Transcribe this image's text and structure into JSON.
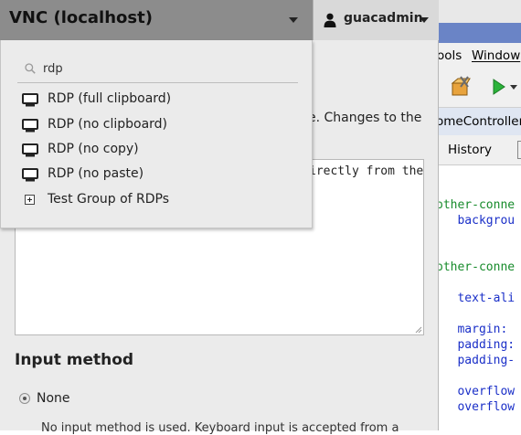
{
  "header": {
    "connection_title": "VNC (localhost)",
    "username": "guacadmin"
  },
  "dropdown": {
    "search_value": "rdp",
    "items": [
      {
        "label": "RDP (full clipboard)",
        "icon": "monitor-icon"
      },
      {
        "label": "RDP (no clipboard)",
        "icon": "monitor-icon"
      },
      {
        "label": "RDP (no copy)",
        "icon": "monitor-icon"
      },
      {
        "label": "RDP (no paste)",
        "icon": "monitor-icon"
      }
    ],
    "group": {
      "label": "Test Group of RDPs",
      "icon": "expand-plus-icon"
    }
  },
  "settings": {
    "description_fragment": "e. Changes to the",
    "clipboard_text_fragment": "irectly from the",
    "input_method_title": "Input method",
    "input_method_option": "None",
    "input_method_help": "No input method is used. Keyboard input is accepted from a"
  },
  "ide": {
    "menu_tools": "ools",
    "menu_window": "Window",
    "editor_tab": "omeController",
    "history_label": "History",
    "code_lines": [
      {
        "text": "other-conne",
        "color": "green"
      },
      {
        "text": "   backgrou",
        "color": "blue"
      },
      {
        "text": "other-conne",
        "color": "green"
      },
      {
        "text": "   text-ali",
        "color": "blue"
      },
      {
        "text": "   margin: ",
        "color": "blue"
      },
      {
        "text": "   padding:",
        "color": "blue"
      },
      {
        "text": "   padding-",
        "color": "blue"
      },
      {
        "text": "   overflow",
        "color": "blue"
      },
      {
        "text": "   overflow",
        "color": "blue"
      }
    ]
  }
}
